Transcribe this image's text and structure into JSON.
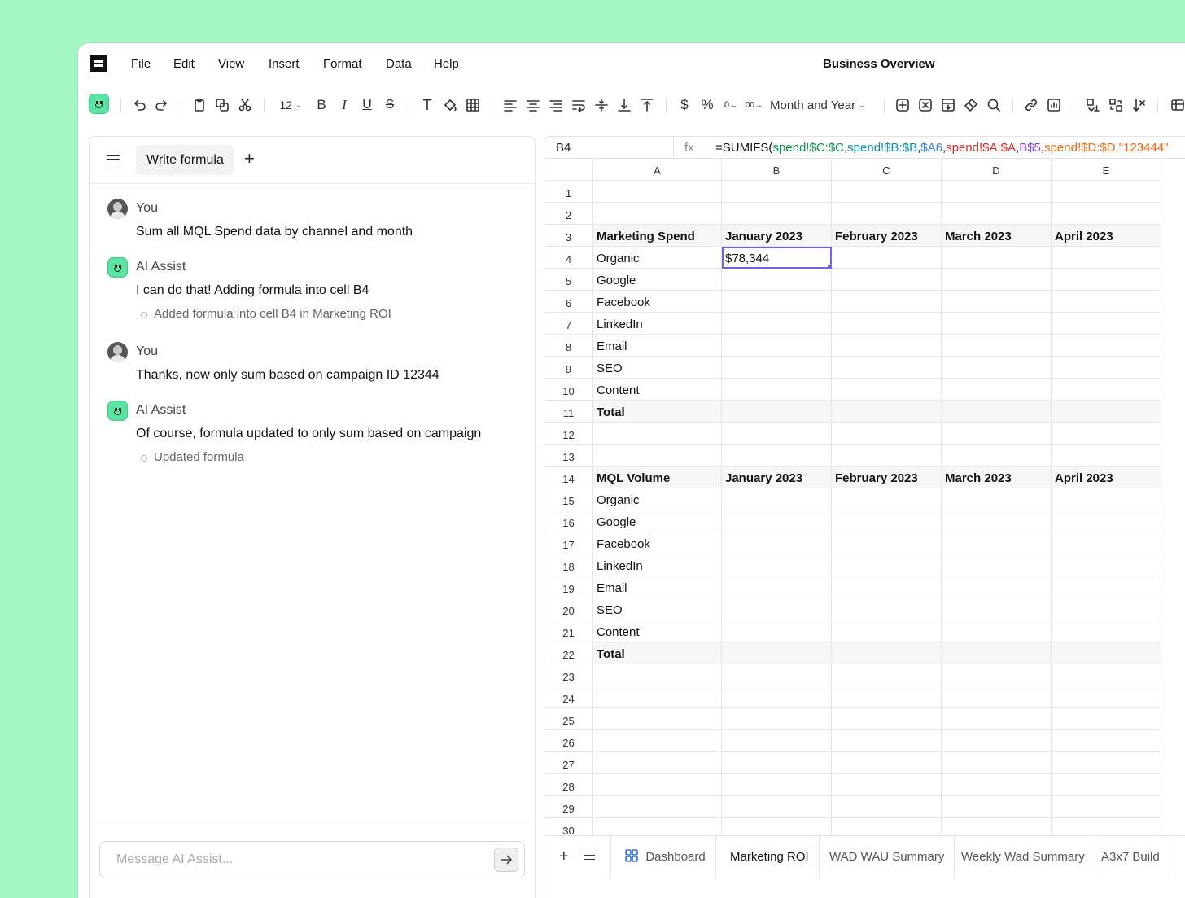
{
  "menu": [
    "File",
    "Edit",
    "View",
    "Insert",
    "Format",
    "Data",
    "Help"
  ],
  "doc_title": "Business Overview",
  "toolbar": {
    "font_size": "12",
    "number_format": "Month and Year"
  },
  "assistant": {
    "tab_label": "Write formula",
    "messages": [
      {
        "sender": "You",
        "text": "Sum all MQL Spend data by channel and month"
      },
      {
        "sender": "AI Assist",
        "text": "I can do that! Adding formula into cell B4",
        "note": "Added formula into cell B4 in  Marketing ROI"
      },
      {
        "sender": "You",
        "text": "Thanks, now only sum based on campaign ID 12344"
      },
      {
        "sender": "AI Assist",
        "text": "Of course, formula updated to only sum based on campaign",
        "note": "Updated formula"
      }
    ],
    "input_placeholder": "Message AI Assist..."
  },
  "sheet": {
    "cell_ref": "B4",
    "fx": "fx",
    "formula_parts": [
      {
        "t": "=SUMIFS(",
        "color": "#111111"
      },
      {
        "t": "spend!$C:$C",
        "color": "#0a8f4a"
      },
      {
        "t": ",",
        "color": "#111111"
      },
      {
        "t": "spend!$B:$B",
        "color": "#0b8fa8"
      },
      {
        "t": ",",
        "color": "#111111"
      },
      {
        "t": "$A6",
        "color": "#2f7fe0"
      },
      {
        "t": ",",
        "color": "#111111"
      },
      {
        "t": "spend!$A:$A",
        "color": "#d22a2a"
      },
      {
        "t": ",",
        "color": "#111111"
      },
      {
        "t": "B$5",
        "color": "#8a3ff0"
      },
      {
        "t": ",",
        "color": "#111111"
      },
      {
        "t": "spend!$D:$D,\"123444\"",
        "color": "#ec6a12"
      }
    ],
    "columns": [
      "A",
      "B",
      "C",
      "D",
      "E"
    ],
    "rows": [
      [
        "",
        "",
        "",
        "",
        ""
      ],
      [
        "",
        "",
        "",
        "",
        ""
      ],
      [
        "Marketing Spend",
        "January 2023",
        "February 2023",
        "March 2023",
        "April 2023"
      ],
      [
        "Organic",
        "$78,344",
        "",
        "",
        ""
      ],
      [
        "Google",
        "",
        "",
        "",
        ""
      ],
      [
        "Facebook",
        "",
        "",
        "",
        ""
      ],
      [
        "LinkedIn",
        "",
        "",
        "",
        ""
      ],
      [
        "Email",
        "",
        "",
        "",
        ""
      ],
      [
        "SEO",
        "",
        "",
        "",
        ""
      ],
      [
        "Content",
        "",
        "",
        "",
        ""
      ],
      [
        "Total",
        "",
        "",
        "",
        ""
      ],
      [
        "",
        "",
        "",
        "",
        ""
      ],
      [
        "",
        "",
        "",
        "",
        ""
      ],
      [
        "MQL Volume",
        "January 2023",
        "February 2023",
        "March 2023",
        "April 2023"
      ],
      [
        "Organic",
        "",
        "",
        "",
        ""
      ],
      [
        "Google",
        "",
        "",
        "",
        ""
      ],
      [
        "Facebook",
        "",
        "",
        "",
        ""
      ],
      [
        "LinkedIn",
        "",
        "",
        "",
        ""
      ],
      [
        "Email",
        "",
        "",
        "",
        ""
      ],
      [
        "SEO",
        "",
        "",
        "",
        ""
      ],
      [
        "Content",
        "",
        "",
        "",
        ""
      ],
      [
        "Total",
        "",
        "",
        "",
        ""
      ],
      [
        "",
        "",
        "",
        "",
        ""
      ],
      [
        "",
        "",
        "",
        "",
        ""
      ],
      [
        "",
        "",
        "",
        "",
        ""
      ],
      [
        "",
        "",
        "",
        "",
        ""
      ],
      [
        "",
        "",
        "",
        "",
        ""
      ],
      [
        "",
        "",
        "",
        "",
        ""
      ],
      [
        "",
        "",
        "",
        "",
        ""
      ],
      [
        "",
        "",
        "",
        "",
        ""
      ]
    ],
    "header_rows": [
      3,
      14
    ],
    "bold_rows": [
      3,
      11,
      14,
      22
    ],
    "selected": {
      "row": 4,
      "col": 1
    },
    "tabs": [
      "Dashboard",
      "Marketing ROI",
      "WAD WAU Summary",
      "Weekly Wad Summary",
      "A3x7 Build"
    ],
    "active_tab": "Marketing ROI"
  }
}
